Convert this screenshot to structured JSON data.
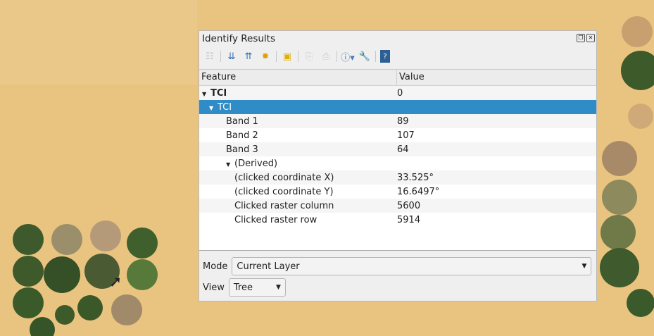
{
  "dialog": {
    "title": "Identify Results"
  },
  "toolbar": [
    "expand-tree",
    "expand-all",
    "collapse-all",
    "expand-new",
    "clear-results",
    "copy",
    "print",
    "select-mode",
    "settings",
    "help"
  ],
  "table": {
    "headers": [
      "Feature",
      "Value"
    ],
    "rows": [
      {
        "feature": "TCI",
        "value": "0",
        "level": 0,
        "bold": true,
        "arrow": true
      },
      {
        "feature": "TCI",
        "value": "",
        "level": 1,
        "selected": true,
        "arrow": true
      },
      {
        "feature": "Band 1",
        "value": "89",
        "level": 2
      },
      {
        "feature": "Band 2",
        "value": "107",
        "level": 2
      },
      {
        "feature": "Band 3",
        "value": "64",
        "level": 2
      },
      {
        "feature": "(Derived)",
        "value": "",
        "level": 2,
        "arrow": true
      },
      {
        "feature": "(clicked coordinate X)",
        "value": "33.525°",
        "level": 3
      },
      {
        "feature": "(clicked coordinate Y)",
        "value": "16.6497°",
        "level": 3
      },
      {
        "feature": "Clicked raster column",
        "value": "5600",
        "level": 3
      },
      {
        "feature": "Clicked raster row",
        "value": "5914",
        "level": 3
      }
    ]
  },
  "mode": {
    "label": "Mode",
    "value": "Current Layer"
  },
  "view": {
    "label": "View",
    "value": "Tree"
  },
  "colors": {
    "selection": "#308cc6",
    "desert": "#e9c27f"
  }
}
